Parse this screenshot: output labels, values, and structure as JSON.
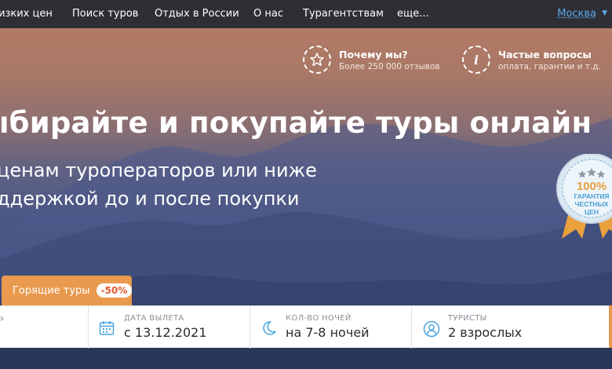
{
  "nav": {
    "items": [
      "изких цен",
      "Поиск туров",
      "Отдых в России",
      "О нас",
      "Турагентствам",
      "еще..."
    ],
    "city": "Москва"
  },
  "info": {
    "why_title": "Почему мы?",
    "why_sub": "Более 250 000 отзывов",
    "faq_title": "Частые вопросы",
    "faq_sub": "оплата, гарантии и т.д."
  },
  "hero": {
    "headline": "ыбирайте и покупайте туры онлайн",
    "sub1": "ценам туроператоров или ниже",
    "sub2": "ддержкой до и после покупки"
  },
  "badge": {
    "percent": "100%",
    "line1": "ГАРАНТИЯ",
    "line2": "ЧЕСТНЫХ",
    "line3": "ЦЕН"
  },
  "hot_tours": {
    "label": "Горящие туры",
    "discount": "-50%"
  },
  "search": {
    "first_label": "Ь",
    "date_label": "ДАТА ВЫЛЕТА",
    "date_value": "с 13.12.2021",
    "nights_label": "КОЛ-ВО НОЧЕЙ",
    "nights_value": "на 7-8 ночей",
    "tourists_label": "ТУРИСТЫ",
    "tourists_value": "2 взрослых"
  },
  "colors": {
    "nav_bg": "#2f2e34",
    "accent_orange": "#e99a4f",
    "link_blue": "#5aa9e6",
    "icon_blue": "#4aa3df"
  },
  "icons": {
    "why": "star-icon",
    "faq": "info-icon",
    "date": "calendar-icon",
    "nights": "moon-icon",
    "tourists": "user-icon"
  }
}
